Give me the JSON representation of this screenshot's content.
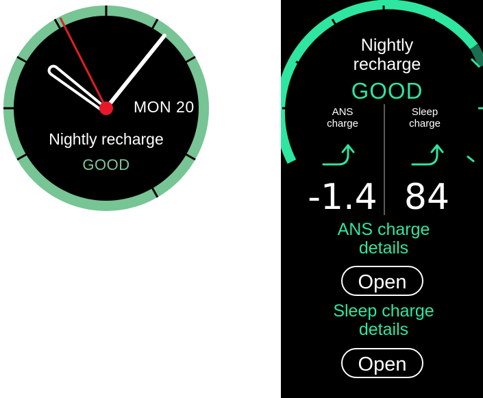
{
  "watch_face": {
    "date": "MON 20",
    "title": "Nightly recharge",
    "status": "GOOD",
    "colors": {
      "ring": "#77c494",
      "status": "#7ec89a",
      "second_hand": "#e02020",
      "center_dot": "#e8182a"
    }
  },
  "detail": {
    "title_line1": "Nightly",
    "title_line2": "recharge",
    "status": "GOOD",
    "ans": {
      "label_line1": "ANS",
      "label_line2": "charge",
      "value": "-1.4",
      "details_line1": "ANS charge",
      "details_line2": "details",
      "open_label": "Open"
    },
    "sleep": {
      "label_line1": "Sleep",
      "label_line2": "charge",
      "value": "84",
      "details_line1": "Sleep charge",
      "details_line2": "details",
      "open_label": "Open"
    },
    "colors": {
      "accent": "#2ee6a0",
      "background": "#000000"
    }
  }
}
